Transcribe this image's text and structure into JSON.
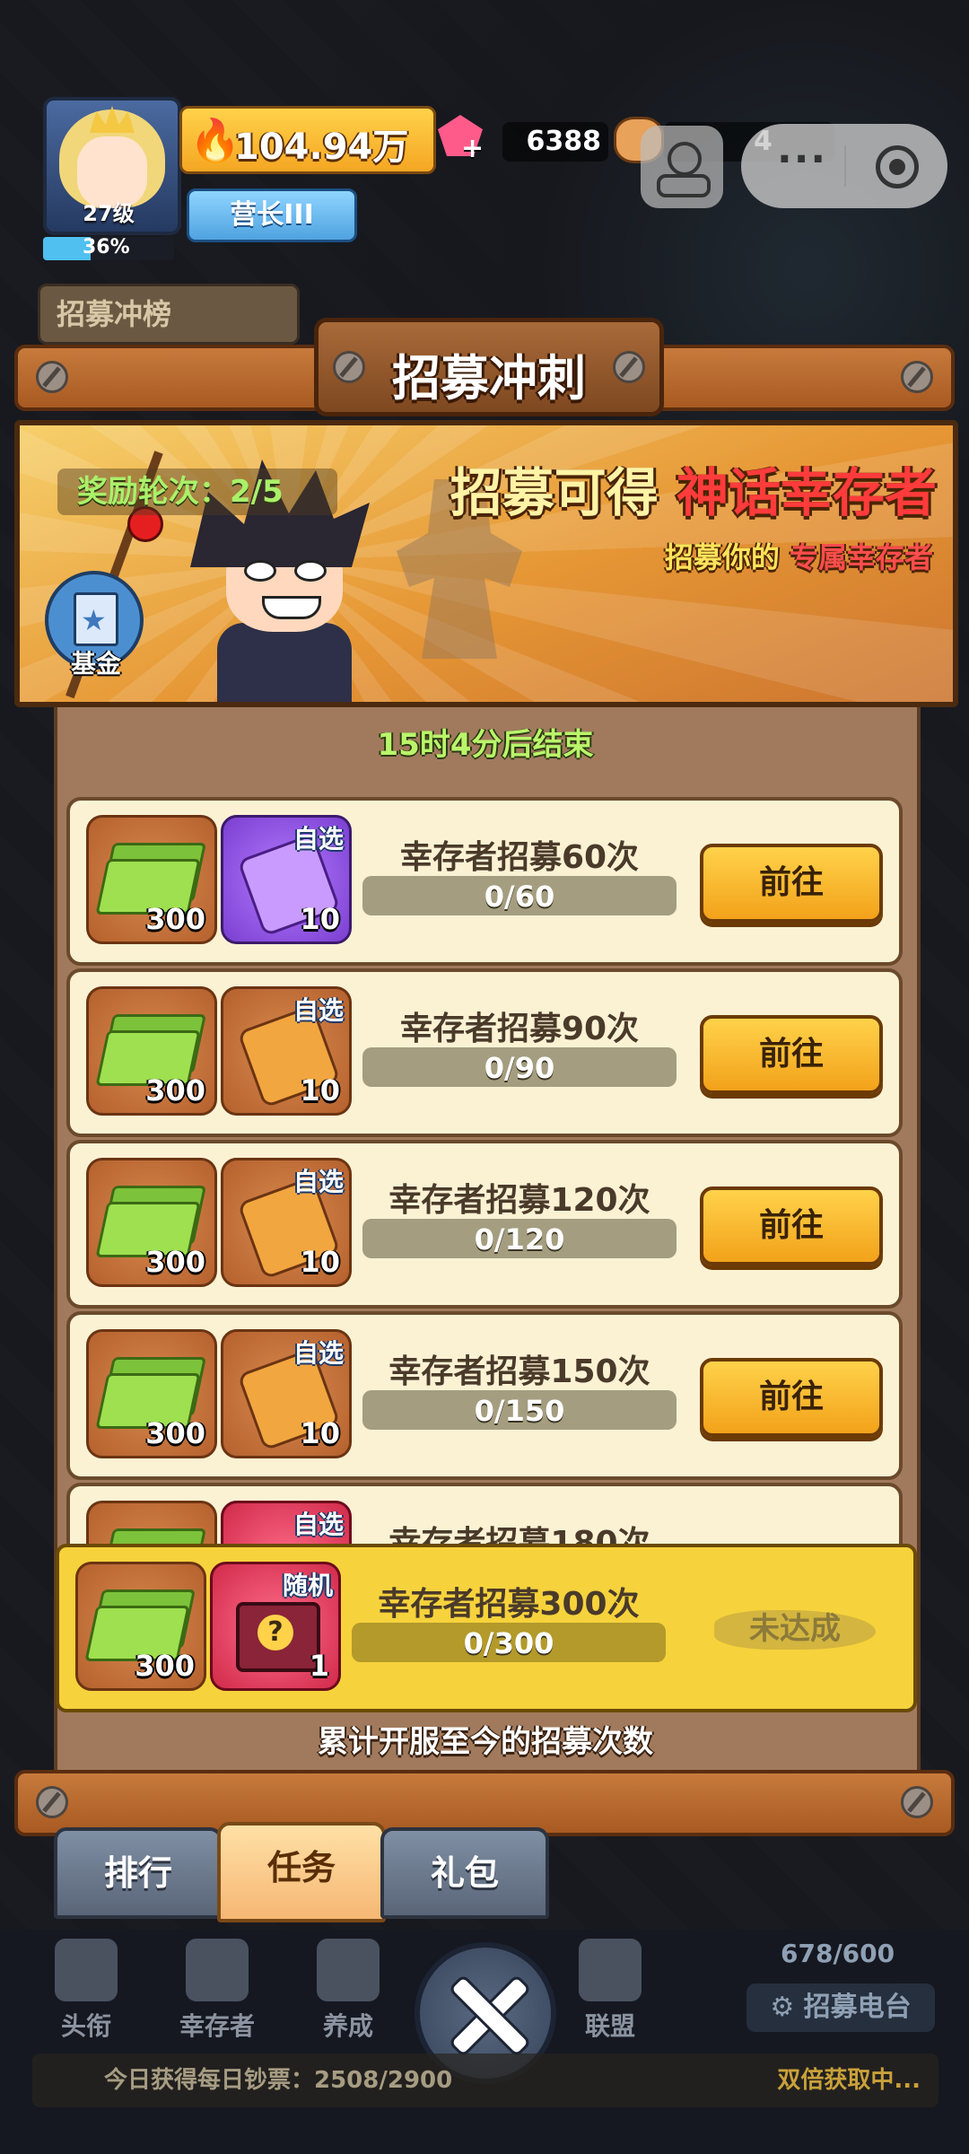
{
  "hud": {
    "level": "27级",
    "xp_percent": "36%",
    "xp_fraction": 0.36,
    "power": "104.94万",
    "rank": "营长III",
    "gems": "6388",
    "fists": "4"
  },
  "side_tab": "招募冲榜",
  "panel": {
    "title": "招募冲刺",
    "rounds": "奖励轮次：2/5",
    "banner_title_a": "招募可得",
    "banner_title_b": "神话幸存者",
    "banner_sub_a": "招募你的",
    "banner_sub_b": "专属幸存者",
    "fund": "基金",
    "end_time": "15时4分后结束",
    "footnote": "累计开服至今的招募次数"
  },
  "tasks": [
    {
      "title": "幸存者招募60次",
      "progress": "0/60",
      "cash": "300",
      "piece_tag": "自选",
      "piece_count": "10",
      "button": "前往"
    },
    {
      "title": "幸存者招募90次",
      "progress": "0/90",
      "cash": "300",
      "piece_tag": "自选",
      "piece_count": "10",
      "button": "前往"
    },
    {
      "title": "幸存者招募120次",
      "progress": "0/120",
      "cash": "300",
      "piece_tag": "自选",
      "piece_count": "10",
      "button": "前往"
    },
    {
      "title": "幸存者招募150次",
      "progress": "0/150",
      "cash": "300",
      "piece_tag": "自选",
      "piece_count": "10",
      "button": "前往"
    },
    {
      "title": "幸存者招募180次",
      "piece_tag": "自选"
    }
  ],
  "final_task": {
    "title": "幸存者招募300次",
    "progress": "0/300",
    "cash": "300",
    "piece_tag": "随机",
    "piece_count": "1",
    "status": "未达成"
  },
  "tabs": [
    "排行",
    "任务",
    "礼包"
  ],
  "nav": [
    "头衔",
    "幸存者",
    "养成",
    "联盟"
  ],
  "radio": {
    "count": "678/600",
    "label": "招募电台"
  },
  "bottom": {
    "left": "今日获得每日钞票：2508/2900",
    "right": "双倍获取中..."
  },
  "colors": {
    "accent": "#f6d23c",
    "button": "#ffd24a",
    "progress_text": "#ffffff"
  }
}
